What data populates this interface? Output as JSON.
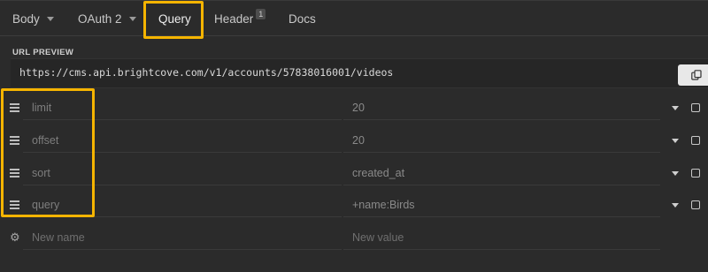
{
  "tabs": [
    {
      "label": "Body",
      "dropdown": true
    },
    {
      "label": "OAuth 2",
      "dropdown": true
    },
    {
      "label": "Query",
      "active": true
    },
    {
      "label": "Header",
      "badge": "1"
    },
    {
      "label": "Docs"
    }
  ],
  "url_preview": {
    "label": "URL PREVIEW",
    "url": "https://cms.api.brightcove.com/v1/accounts/57838016001/videos",
    "copy_icon": "copy-icon"
  },
  "params": [
    {
      "name": "limit",
      "value": "20"
    },
    {
      "name": "offset",
      "value": "20"
    },
    {
      "name": "sort",
      "value": "created_at"
    },
    {
      "name": "query",
      "value": "+name:Birds"
    }
  ],
  "new_param": {
    "name_placeholder": "New name",
    "value_placeholder": "New value",
    "icon": "gear-icon"
  },
  "colors": {
    "background": "#2b2b2b",
    "highlight": "#f5b400"
  }
}
